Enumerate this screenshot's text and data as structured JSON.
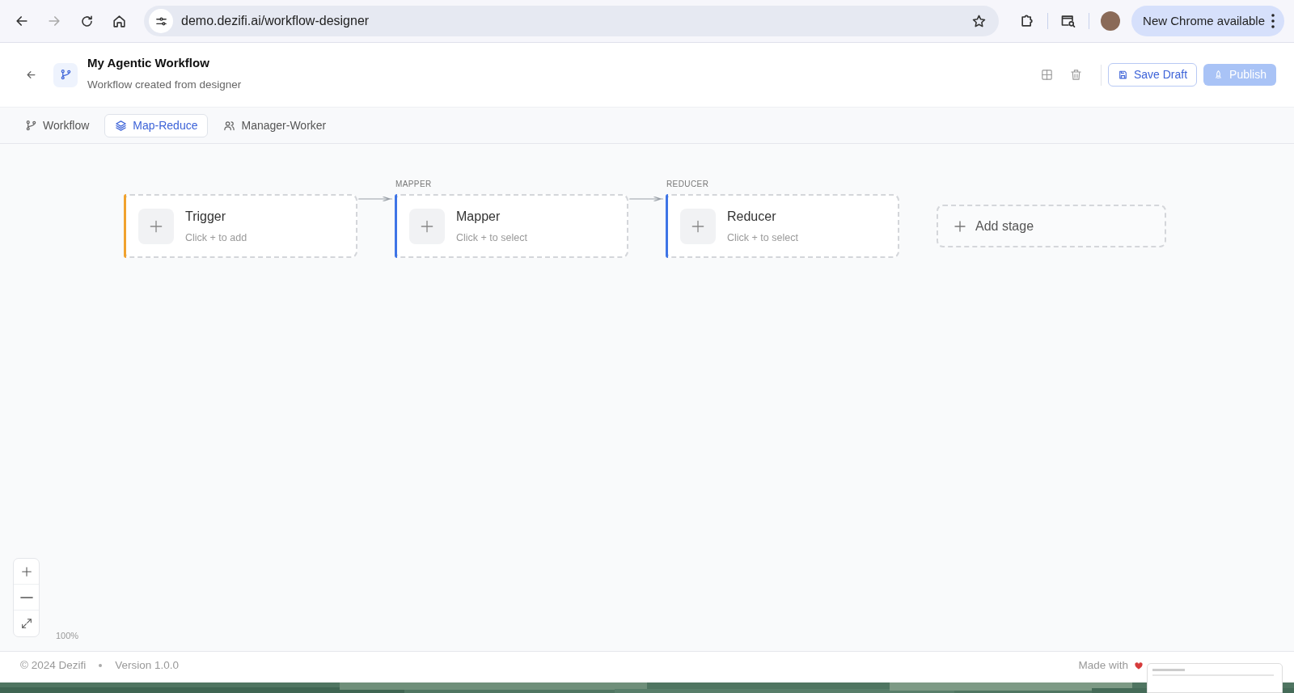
{
  "browser": {
    "url": "demo.dezifi.ai/workflow-designer",
    "forward_disabled": true,
    "update_button": "New Chrome available"
  },
  "header": {
    "title": "My Agentic Workflow",
    "subtitle": "Workflow created from designer",
    "save_button": "Save Draft",
    "publish_button": "Publish",
    "publish_disabled": true
  },
  "tabs": [
    {
      "label": "Workflow",
      "kind": "branch",
      "selected": false
    },
    {
      "label": "Map-Reduce",
      "kind": "layers",
      "selected": true
    },
    {
      "label": "Manager-Worker",
      "kind": "people",
      "selected": false
    }
  ],
  "stages": [
    {
      "title": "Trigger",
      "hint": "Click + to add",
      "color": "#f0a22e"
    },
    {
      "label": "MAPPER",
      "title": "Mapper",
      "hint": "Click + to select",
      "color": "#3e74e6"
    },
    {
      "label": "REDUCER",
      "title": "Reducer",
      "hint": "Click + to select",
      "color": "#3e74e6"
    }
  ],
  "add_stage": "Add stage",
  "zoom_level": "100%",
  "footer": {
    "copyright": "© 2024 Dezifi",
    "version": "Version 1.0.0",
    "made_with": "Made with"
  }
}
